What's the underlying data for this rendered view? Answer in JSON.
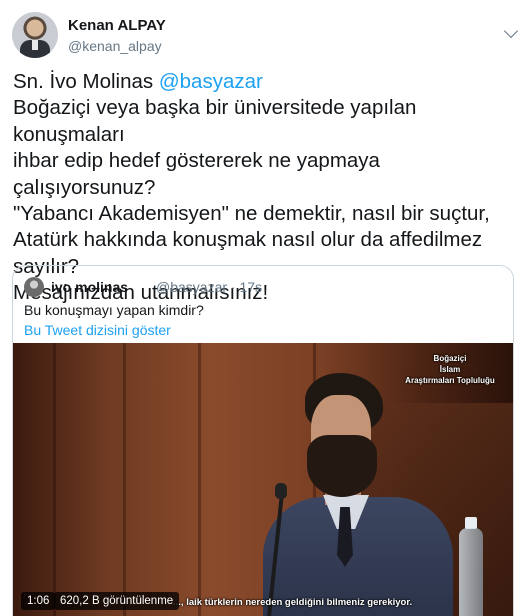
{
  "author": {
    "display_name": "Kenan ALPAY",
    "handle": "@kenan_alpay",
    "avatar": "avatar-photo"
  },
  "tweet": {
    "line1_prefix": "Sn. İvo Molinas ",
    "line1_mention": "@basyazar",
    "rest": "Boğaziçi veya başka bir üniversitede yapılan  konuşmaları\nihbar edip hedef göstererek ne yapmaya çalışıyorsunuz?\n\"Yabancı Akademisyen\" ne demektir, nasıl bir suçtur,\nAtatürk hakkında konuşmak nasıl olur da affedilmez\nsayılır?\nMesajınızdan utanmalısınız!"
  },
  "quoted": {
    "display_name": "ivo molinas",
    "meta": "@basyazar · 17s",
    "text": "Bu konuşmayı yapan kimdir?",
    "thread_link": "Bu Tweet dizisini göster",
    "video": {
      "logo_lines": [
        "Boğaziçi",
        "İslam",
        "Araştırmaları Topluluğu"
      ],
      "subtitle": "..., laik türklerin nereden geldiğini bilmeniz gerekiyor.",
      "duration": "1:06",
      "views": "620,2 B görüntülenme"
    }
  },
  "colors": {
    "accent": "#1da1f2",
    "text": "#14171a",
    "muted": "#657786",
    "border": "#ccd6dd"
  },
  "icons": {
    "menu": "chevron-down-icon"
  }
}
